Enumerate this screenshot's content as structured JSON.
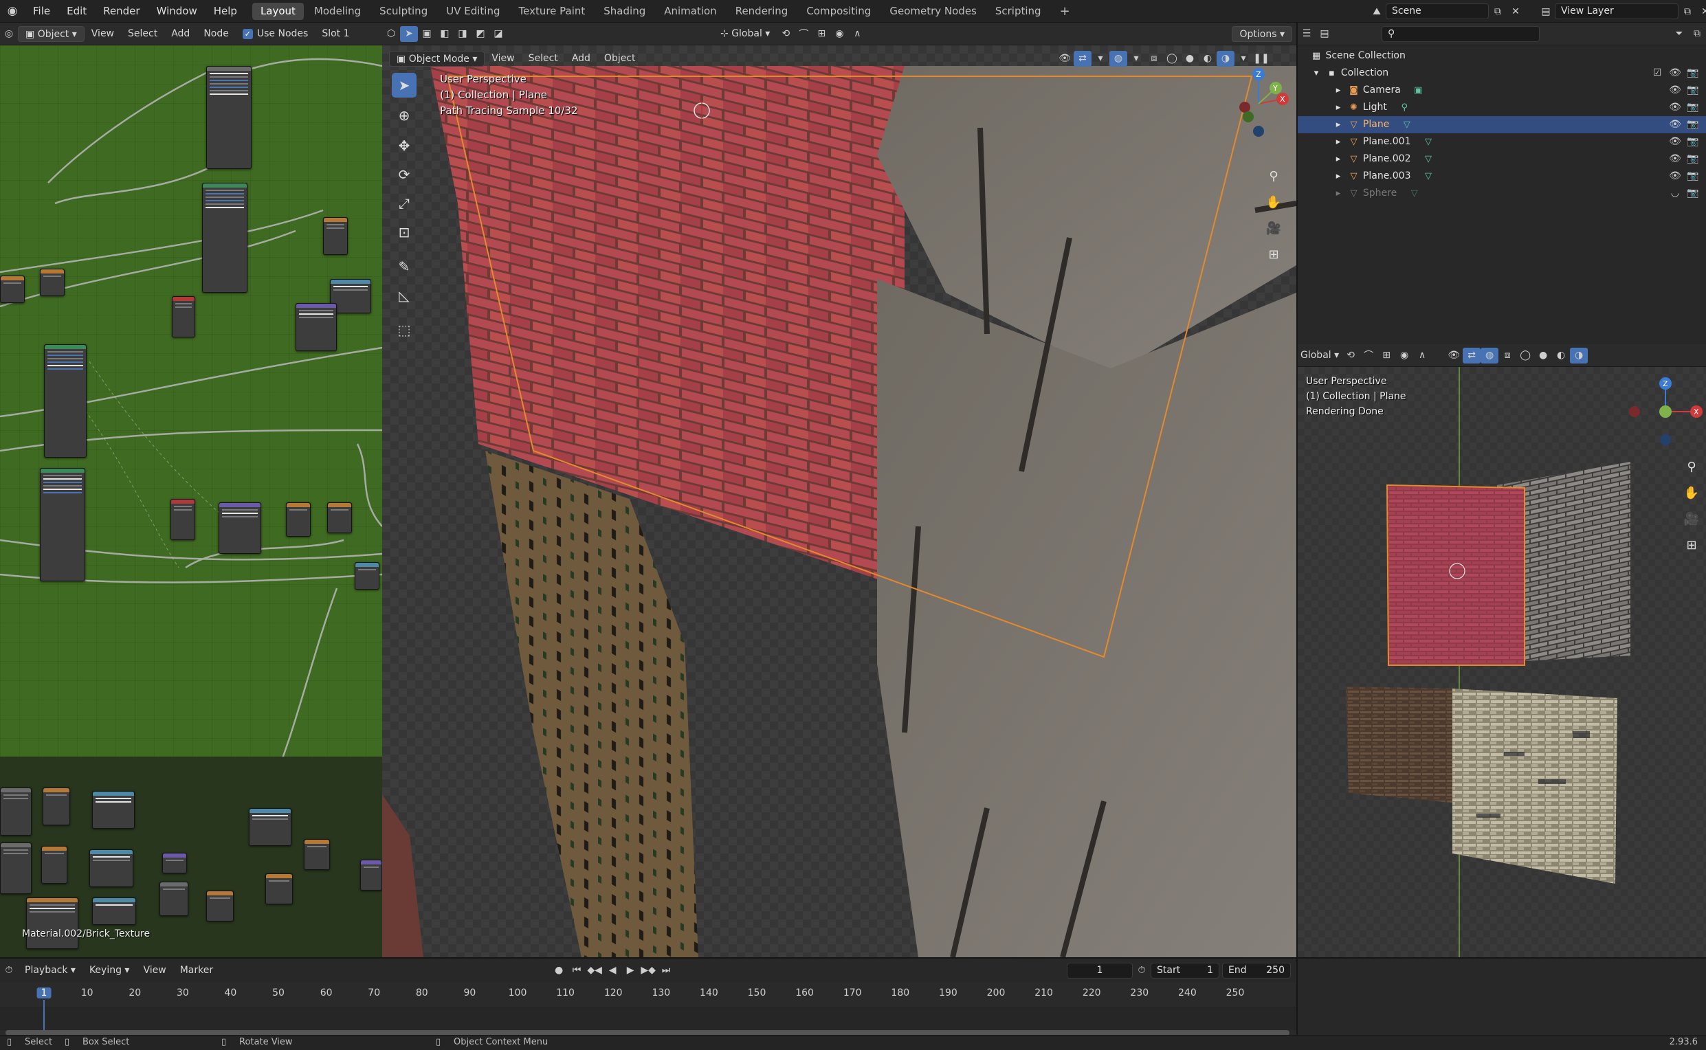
{
  "menu": [
    "File",
    "Edit",
    "Render",
    "Window",
    "Help"
  ],
  "workspaces": [
    "Layout",
    "Modeling",
    "Sculpting",
    "UV Editing",
    "Texture Paint",
    "Shading",
    "Animation",
    "Rendering",
    "Compositing",
    "Geometry Nodes",
    "Scripting"
  ],
  "active_workspace": "Layout",
  "scene_name": "Scene",
  "view_layer": "View Layer",
  "node_editor": {
    "mode": "Object",
    "menus": [
      "View",
      "Select",
      "Add",
      "Node"
    ],
    "use_nodes_label": "Use Nodes",
    "slot": "Slot 1",
    "material_label": "Material.002/Brick_Texture"
  },
  "viewport_header": {
    "orientation": "Global",
    "options": "Options",
    "mode": "Object Mode",
    "menus": [
      "View",
      "Select",
      "Add",
      "Object"
    ]
  },
  "viewport_overlay": {
    "line1": "User Perspective",
    "line2": "(1) Collection | Plane",
    "line3": "Path Tracing Sample 10/32"
  },
  "outliner": {
    "root": "Scene Collection",
    "collection": "Collection",
    "items": [
      {
        "name": "Camera",
        "icon": "camera-icon"
      },
      {
        "name": "Light",
        "icon": "light-icon"
      },
      {
        "name": "Plane",
        "icon": "mesh-icon",
        "selected": true
      },
      {
        "name": "Plane.001",
        "icon": "mesh-icon"
      },
      {
        "name": "Plane.002",
        "icon": "mesh-icon"
      },
      {
        "name": "Plane.003",
        "icon": "mesh-icon"
      },
      {
        "name": "Sphere",
        "icon": "mesh-icon",
        "hidden": true
      }
    ]
  },
  "mini_viewport": {
    "orientation": "Global",
    "line1": "User Perspective",
    "line2": "(1) Collection | Plane",
    "line3": "Rendering Done"
  },
  "timeline": {
    "menus": [
      "Playback",
      "Keying",
      "View",
      "Marker"
    ],
    "current_frame": "1",
    "start_label": "Start",
    "start": "1",
    "end_label": "End",
    "end": "250",
    "ticks": [
      "1",
      "10",
      "20",
      "30",
      "40",
      "50",
      "60",
      "70",
      "80",
      "90",
      "100",
      "110",
      "120",
      "130",
      "140",
      "150",
      "160",
      "170",
      "180",
      "190",
      "200",
      "210",
      "220",
      "230",
      "240",
      "250"
    ]
  },
  "statusbar": {
    "select": "Select",
    "box_select": "Box Select",
    "rotate_view": "Rotate View",
    "context_menu": "Object Context Menu",
    "version": "2.93.6"
  }
}
